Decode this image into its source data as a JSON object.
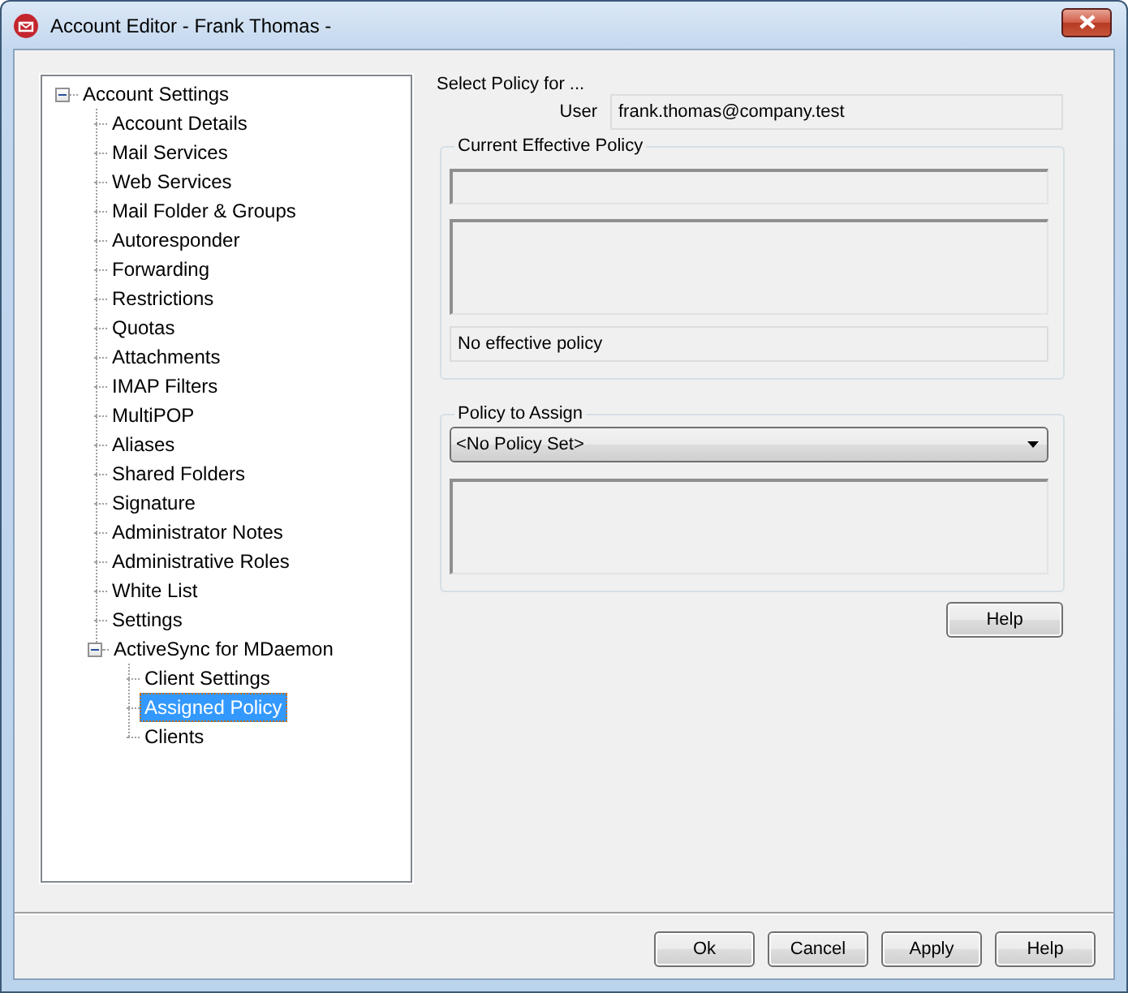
{
  "window": {
    "title": "Account Editor - Frank Thomas -"
  },
  "tree": [
    {
      "label": "Account Settings",
      "expanded": true,
      "selected": false,
      "children": [
        {
          "label": "Account Details",
          "selected": false
        },
        {
          "label": "Mail Services",
          "selected": false
        },
        {
          "label": "Web Services",
          "selected": false
        },
        {
          "label": "Mail Folder & Groups",
          "selected": false
        },
        {
          "label": "Autoresponder",
          "selected": false
        },
        {
          "label": "Forwarding",
          "selected": false
        },
        {
          "label": "Restrictions",
          "selected": false
        },
        {
          "label": "Quotas",
          "selected": false
        },
        {
          "label": "Attachments",
          "selected": false
        },
        {
          "label": "IMAP Filters",
          "selected": false
        },
        {
          "label": "MultiPOP",
          "selected": false
        },
        {
          "label": "Aliases",
          "selected": false
        },
        {
          "label": "Shared Folders",
          "selected": false
        },
        {
          "label": "Signature",
          "selected": false
        },
        {
          "label": "Administrator Notes",
          "selected": false
        },
        {
          "label": "Administrative Roles",
          "selected": false
        },
        {
          "label": "White List",
          "selected": false
        },
        {
          "label": "Settings",
          "selected": false
        },
        {
          "label": "ActiveSync for MDaemon",
          "expanded": true,
          "selected": false,
          "children": [
            {
              "label": "Client Settings",
              "selected": false
            },
            {
              "label": "Assigned Policy",
              "selected": true
            },
            {
              "label": "Clients",
              "selected": false
            }
          ]
        }
      ]
    }
  ],
  "policy": {
    "heading": "Select Policy for ...",
    "user_label": "User",
    "user_value": "frank.thomas@company.test",
    "current_group": {
      "title": "Current Effective Policy",
      "status": "No effective policy"
    },
    "assign_group": {
      "title": "Policy to Assign",
      "dropdown": "<No Policy Set>"
    },
    "help_button": "Help"
  },
  "buttons": [
    "Ok",
    "Cancel",
    "Apply",
    "Help"
  ]
}
